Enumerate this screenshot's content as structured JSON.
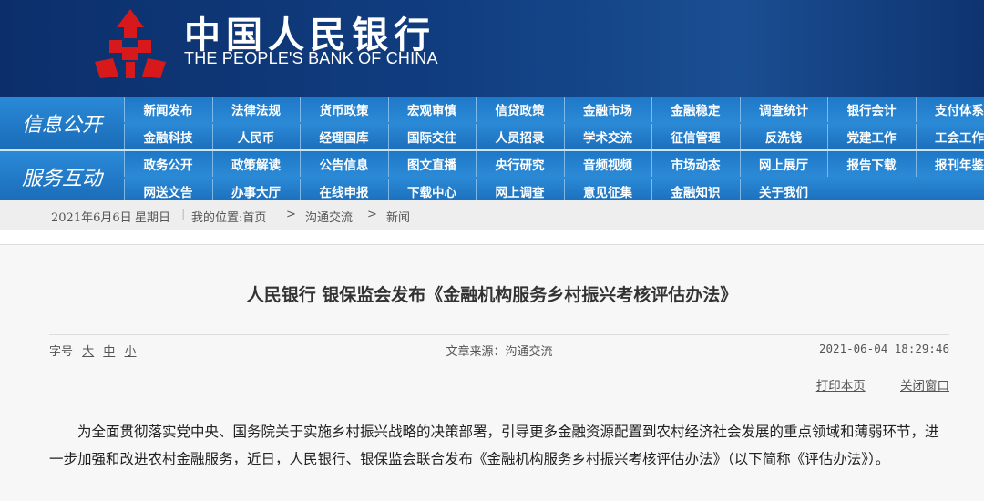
{
  "header": {
    "cn_name": "中国人民银行",
    "en_name": "THE PEOPLE'S BANK OF CHINA",
    "logo_color": "#d8191c"
  },
  "nav": {
    "info_title": "信息公开",
    "info_row1": [
      "新闻发布",
      "法律法规",
      "货币政策",
      "宏观审慎",
      "信贷政策",
      "金融市场",
      "金融稳定",
      "调查统计",
      "银行会计",
      "支付体系"
    ],
    "info_row2": [
      "金融科技",
      "人民币",
      "经理国库",
      "国际交往",
      "人员招录",
      "学术交流",
      "征信管理",
      "反洗钱",
      "党建工作",
      "工会工作"
    ],
    "service_title": "服务互动",
    "service_row1": [
      "政务公开",
      "政策解读",
      "公告信息",
      "图文直播",
      "央行研究",
      "音频视频",
      "市场动态",
      "网上展厅",
      "报告下载",
      "报刊年鉴"
    ],
    "service_row2": [
      "网送文告",
      "办事大厅",
      "在线申报",
      "下载中心",
      "网上调查",
      "意见征集",
      "金融知识",
      "关于我们"
    ]
  },
  "crumb": {
    "date": "2021年6月6日",
    "weekday": "星期日",
    "location_label": "我的位置:首页",
    "sep1": ">",
    "level2": "沟通交流",
    "sep2": ">",
    "level3": "新闻"
  },
  "article": {
    "title": "人民银行 银保监会发布《金融机构服务乡村振兴考核评估办法》",
    "font_label": "字号",
    "font_large": "大",
    "font_medium": "中",
    "font_small": "小",
    "source": "文章来源：沟通交流",
    "datetime": "2021-06-04 18:29:46",
    "print": "打印本页",
    "close": "关闭窗口",
    "paragraph": "为全面贯彻落实党中央、国务院关于实施乡村振兴战略的决策部署，引导更多金融资源配置到农村经济社会发展的重点领域和薄弱环节，进一步加强和改进农村金融服务，近日，人民银行、银保监会联合发布《金融机构服务乡村振兴考核评估办法》（以下简称《评估办法》）。"
  }
}
